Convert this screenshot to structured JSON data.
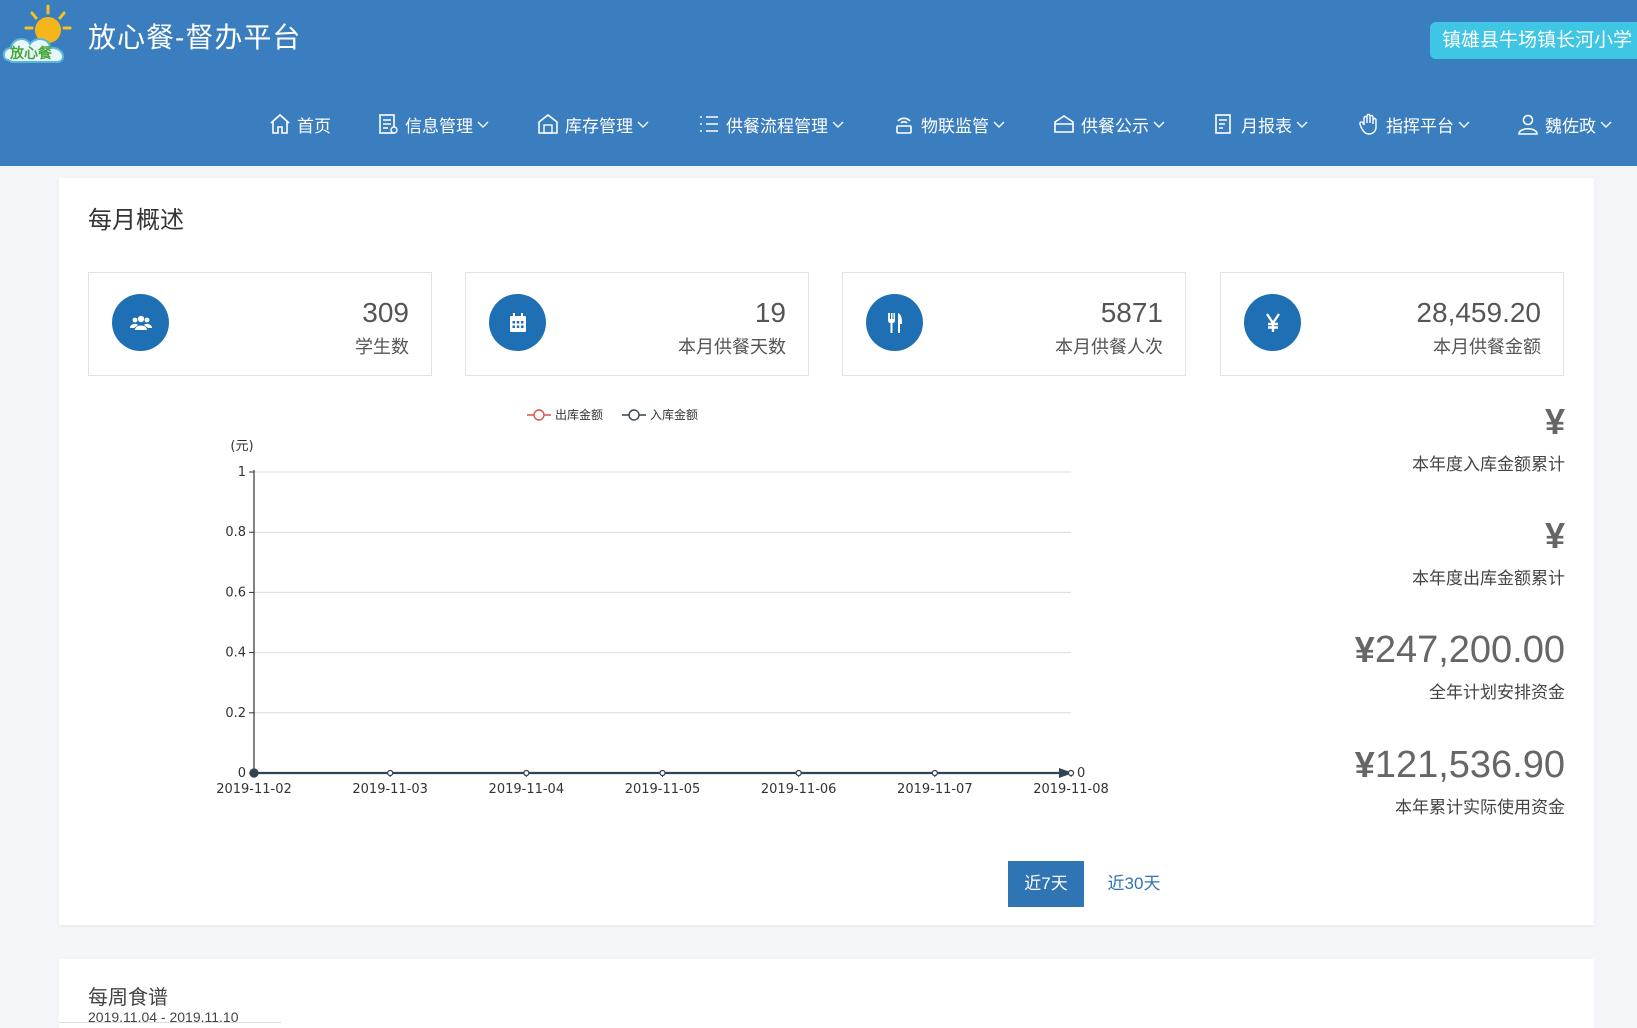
{
  "header": {
    "app_title": "放心餐-督办平台",
    "school": "镇雄县牛场镇长河小学",
    "logo_text": "放心餐"
  },
  "nav": [
    {
      "label": "首页",
      "icon": "home-icon",
      "dropdown": false
    },
    {
      "label": "信息管理",
      "icon": "document-list-icon",
      "dropdown": true
    },
    {
      "label": "库存管理",
      "icon": "warehouse-icon",
      "dropdown": true
    },
    {
      "label": "供餐流程管理",
      "icon": "checklist-icon",
      "dropdown": true
    },
    {
      "label": "物联监管",
      "icon": "iot-device-icon",
      "dropdown": true
    },
    {
      "label": "供餐公示",
      "icon": "notice-board-icon",
      "dropdown": true
    },
    {
      "label": "月报表",
      "icon": "report-icon",
      "dropdown": true
    },
    {
      "label": "指挥平台",
      "icon": "hand-icon",
      "dropdown": true
    },
    {
      "label": "魏佐政",
      "icon": "user-icon",
      "dropdown": true
    }
  ],
  "monthly": {
    "title": "每月概述",
    "stats": [
      {
        "value": "309",
        "label": "学生数",
        "icon": "users-icon"
      },
      {
        "value": "19",
        "label": "本月供餐天数",
        "icon": "calendar-icon"
      },
      {
        "value": "5871",
        "label": "本月供餐人次",
        "icon": "fork-knife-icon"
      },
      {
        "value": "28,459.20",
        "label": "本月供餐金额",
        "icon": "yen-icon"
      }
    ],
    "summary": [
      {
        "amount": "",
        "label": "本年度入库金额累计"
      },
      {
        "amount": "",
        "label": "本年度出库金额累计"
      },
      {
        "amount": "247,200.00",
        "label": "全年计划安排资金"
      },
      {
        "amount": "121,536.90",
        "label": "本年累计实际使用资金"
      }
    ],
    "currency_symbol": "¥",
    "range_buttons": {
      "active": "近7天",
      "other": "近30天"
    }
  },
  "chart_data": {
    "type": "line",
    "x": [
      "2019-11-02",
      "2019-11-03",
      "2019-11-04",
      "2019-11-05",
      "2019-11-06",
      "2019-11-07",
      "2019-11-08"
    ],
    "series": [
      {
        "name": "出库金额",
        "color": "#d9534f",
        "values": [
          0,
          0,
          0,
          0,
          0,
          0,
          0
        ]
      },
      {
        "name": "入库金额",
        "color": "#2f4554",
        "values": [
          0,
          0,
          0,
          0,
          0,
          0,
          0
        ]
      }
    ],
    "yunit": "(元)",
    "yticks": [
      "0",
      "0.2",
      "0.4",
      "0.6",
      "0.8",
      "1"
    ],
    "ylim": [
      0,
      1
    ],
    "end_label": "0",
    "legend": "top-center",
    "grid": true
  },
  "weekly": {
    "title": "每周食谱",
    "range": "2019.11.04 - 2019.11.10"
  }
}
